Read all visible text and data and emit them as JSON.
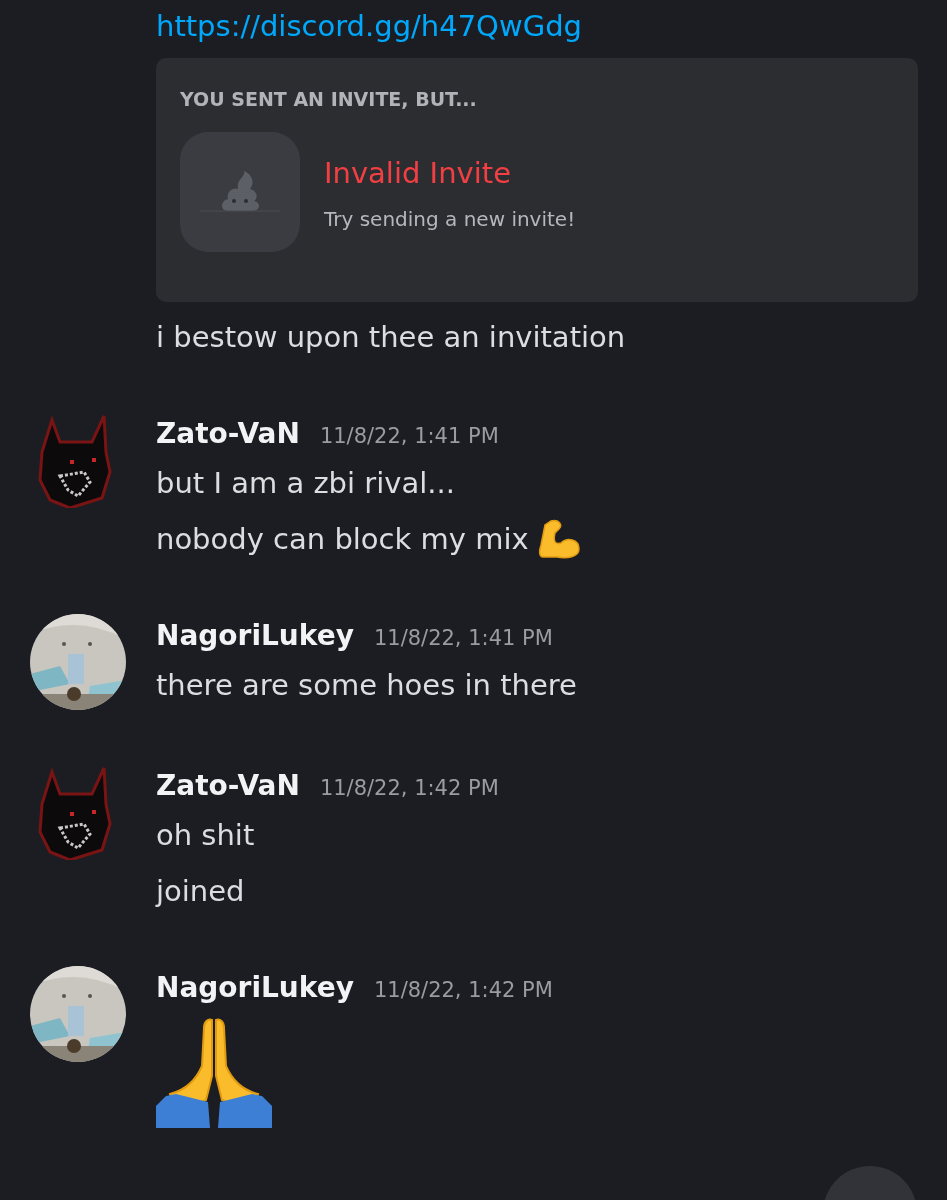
{
  "link": "https://discord.gg/h47QwGdg",
  "invite_card": {
    "heading": "YOU SENT AN INVITE, BUT...",
    "title": "Invalid Invite",
    "subtitle": "Try sending a new invite!"
  },
  "continued_lines": [
    {
      "kind": "text",
      "text": "i bestow upon thee an invitation"
    }
  ],
  "messages": [
    {
      "author": "Zato-VaN",
      "avatar": {
        "kind": "pixel"
      },
      "time": "11/8/22, 1:41 PM",
      "lines": [
        {
          "kind": "text",
          "text": "but I am a zbi rival..."
        },
        {
          "kind": "flex",
          "text": "nobody can block my mix"
        }
      ]
    },
    {
      "author": "NagoriLukey",
      "avatar": {
        "kind": "picture"
      },
      "time": "11/8/22, 1:41 PM",
      "lines": [
        {
          "kind": "text",
          "text": "there are some hoes in there"
        }
      ]
    },
    {
      "author": "Zato-VaN",
      "avatar": {
        "kind": "pixel"
      },
      "time": "11/8/22, 1:42 PM",
      "lines": [
        {
          "kind": "text",
          "text": "oh shit"
        },
        {
          "kind": "text",
          "text": "joined"
        }
      ]
    },
    {
      "author": "NagoriLukey",
      "avatar": {
        "kind": "picture"
      },
      "time": "11/8/22, 1:42 PM",
      "lines": [
        {
          "kind": "pray"
        }
      ]
    }
  ]
}
